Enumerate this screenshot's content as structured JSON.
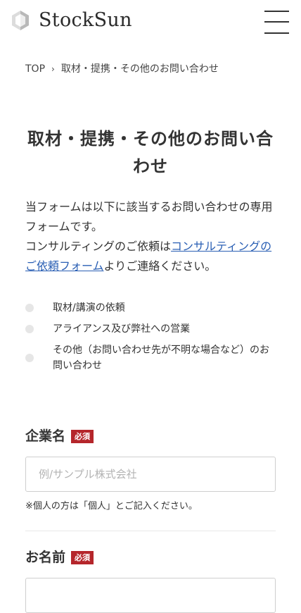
{
  "header": {
    "logo_text": "StockSun",
    "logo_icon": "hexagon-logo-icon",
    "menu_icon": "hamburger-menu-icon"
  },
  "breadcrumb": {
    "home": "TOP",
    "separator": "›",
    "current": "取材・提携・その他のお問い合わせ"
  },
  "page": {
    "title": "取材・提携・その他のお問い合わせ",
    "intro_text": "当フォームは以下に該当するお問い合わせの専用フォームです。",
    "intro_consult_prefix": "コンサルティングのご依頼は",
    "intro_consult_link": "コンサルティングのご依頼フォーム",
    "intro_consult_suffix": "よりご連絡ください。",
    "link_color": "#2a5fb4"
  },
  "purposes": [
    "取材/講演の依頼",
    "アライアンス及び弊社への営業",
    "その他（お問い合わせ先が不明な場合など）のお問い合わせ"
  ],
  "form": {
    "required_label": "必須",
    "required_color": "#b5262b",
    "company": {
      "label": "企業名",
      "placeholder": "例/サンプル株式会社",
      "value": "",
      "note": "※個人の方は「個人」とご記入ください。"
    },
    "name": {
      "label": "お名前",
      "value": ""
    }
  }
}
